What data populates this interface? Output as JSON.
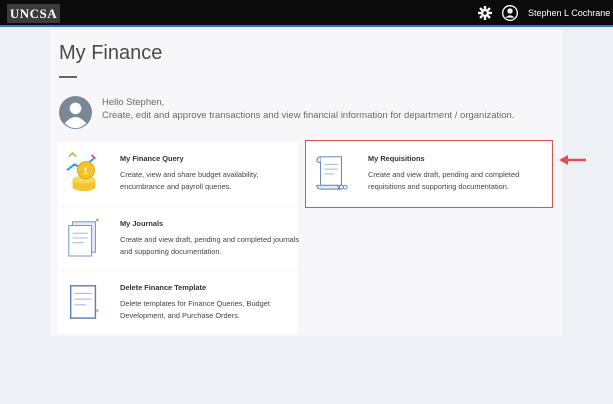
{
  "header": {
    "logo": "UNCSA",
    "user_name": "Stephen L Cochrane"
  },
  "page": {
    "title": "My Finance",
    "greeting": "Hello Stephen,",
    "intro": "Create, edit and approve transactions and view financial information for department / organization."
  },
  "cards": [
    {
      "title": "My Finance Query",
      "description": "Create, view and share budget availability, encumbrance and payroll queries.",
      "icon": "coins-icon"
    },
    {
      "title": "My Journals",
      "description": "Create and view draft, pending and completed journals and supporting documentation.",
      "icon": "journal-icon"
    },
    {
      "title": "Delete Finance Template",
      "description": "Delete templates for Finance Queries, Budget Development, and Purchase Orders.",
      "icon": "template-icon"
    },
    {
      "title": "My Requisitions",
      "description": "Create and view draft, pending and completed requisitions and supporting documentation.",
      "icon": "scroll-icon"
    }
  ],
  "colors": {
    "topbar": "#0b0b0b",
    "accent": "#2d77c7",
    "highlight": "#d9534f"
  }
}
